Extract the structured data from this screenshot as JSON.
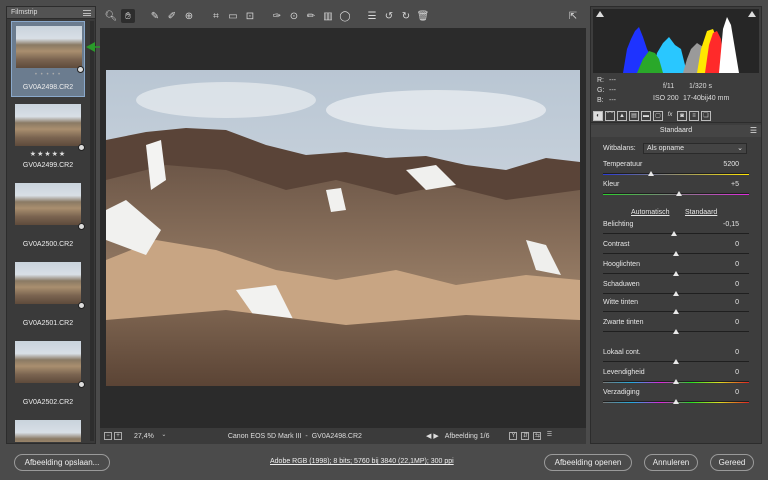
{
  "filmstrip": {
    "title": "Filmstrip",
    "items": [
      {
        "name": "GV0A2498.CR2",
        "stars": "• • • • •"
      },
      {
        "name": "GV0A2499.CR2",
        "stars": "★★★★★"
      },
      {
        "name": "GV0A2500.CR2",
        "stars": ""
      },
      {
        "name": "GV0A2501.CR2",
        "stars": ""
      },
      {
        "name": "GV0A2502.CR2",
        "stars": ""
      }
    ]
  },
  "status": {
    "zoom": "27,4%",
    "camera": "Canon EOS 5D Mark III",
    "separator": "-",
    "file": "GV0A2498.CR2",
    "image_index": "Afbeelding 1/6"
  },
  "readout": {
    "r": "R:",
    "r_val": "---",
    "g": "G:",
    "g_val": "---",
    "b": "B:",
    "b_val": "---",
    "aperture": "f/11",
    "shutter": "1/320 s",
    "iso": "ISO 200",
    "lens": "17-40bij40 mm"
  },
  "panel": {
    "title": "Standaard",
    "white_balance_label": "Witbalans:",
    "white_balance_value": "Als opname",
    "auto_link": "Automatisch",
    "default_link": "Standaard",
    "sliders": [
      {
        "label": "Temperatuur",
        "value": "5200",
        "pos": 0.33
      },
      {
        "label": "Kleur",
        "value": "+5",
        "pos": 0.52
      },
      {
        "label": "Belichting",
        "value": "-0,15",
        "pos": 0.49
      },
      {
        "label": "Contrast",
        "value": "0",
        "pos": 0.5
      },
      {
        "label": "Hooglichten",
        "value": "0",
        "pos": 0.5
      },
      {
        "label": "Schaduwen",
        "value": "0",
        "pos": 0.5
      },
      {
        "label": "Witte tinten",
        "value": "0",
        "pos": 0.5
      },
      {
        "label": "Zwarte tinten",
        "value": "0",
        "pos": 0.5
      },
      {
        "label": "Lokaal cont.",
        "value": "0",
        "pos": 0.5
      },
      {
        "label": "Levendigheid",
        "value": "0",
        "pos": 0.5
      },
      {
        "label": "Verzadiging",
        "value": "0",
        "pos": 0.5
      }
    ]
  },
  "footer": {
    "save": "Afbeelding opslaan...",
    "info": "Adobe RGB (1998); 8 bits; 5760 bij 3840 (22,1MP); 300 ppi",
    "open": "Afbeelding openen",
    "cancel": "Annuleren",
    "done": "Gereed"
  },
  "colors": {
    "accent": "#8aa9cc",
    "arrow": "#2a9a2a"
  },
  "icons": [
    "zoom-icon",
    "hand-icon",
    "white-balance-icon",
    "color-sampler-icon",
    "target-adjust-icon",
    "crop-icon",
    "straighten-icon",
    "transform-icon",
    "spot-removal-icon",
    "red-eye-icon",
    "adjustment-brush-icon",
    "graduated-filter-icon",
    "radial-filter-icon",
    "list-icon",
    "rotate-left-icon",
    "rotate-right-icon",
    "delete-icon"
  ]
}
